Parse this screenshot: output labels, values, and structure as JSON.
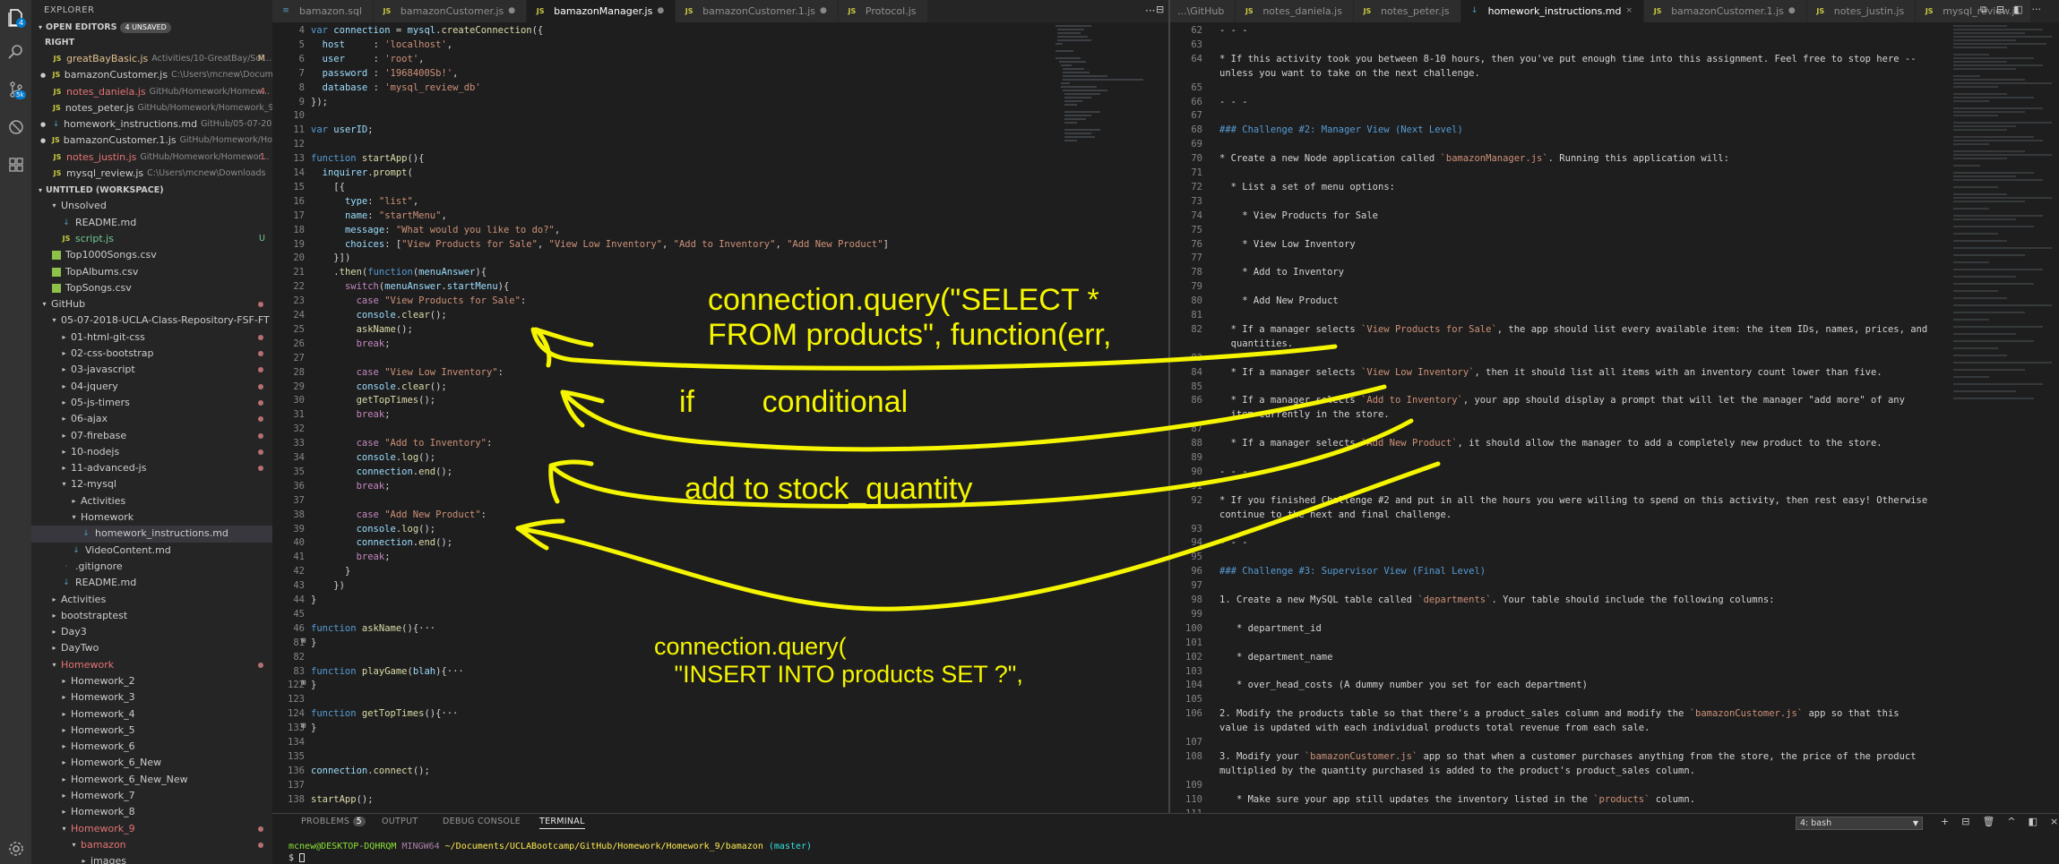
{
  "activity": {
    "badge_top": "4",
    "badge_scm": "5k"
  },
  "explorer": {
    "title": "EXPLORER",
    "open_editors_label": "OPEN EDITORS",
    "unsaved_badge": "4 UNSAVED",
    "group_right": "RIGHT",
    "open_files": [
      {
        "name": "greatBayBasic.js",
        "desc": "Activities/10-GreatBay/Sol...",
        "status": "M"
      },
      {
        "name": "bamazonCustomer.js",
        "desc": "C:\\Users\\mcnew\\Documen...",
        "status": ""
      },
      {
        "name": "notes_daniela.js",
        "desc": "GitHub/Homework/Homew...",
        "status": "4"
      },
      {
        "name": "notes_peter.js",
        "desc": "GitHub/Homework/Homework_9/...",
        "status": ""
      },
      {
        "name": "homework_instructions.md",
        "desc": "GitHub/05-07-2018...",
        "status": ""
      },
      {
        "name": "bamazonCustomer.1.js",
        "desc": "GitHub/Homework/Homew...",
        "status": ""
      },
      {
        "name": "notes_justin.js",
        "desc": "GitHub/Homework/Homewor...",
        "status": "1"
      },
      {
        "name": "mysql_review.js",
        "desc": "C:\\Users\\mcnew\\Downloads",
        "status": ""
      }
    ],
    "workspace_label": "UNTITLED (WORKSPACE)",
    "tree": [
      {
        "name": "Unsolved",
        "indent": 1,
        "type": "folder-open",
        "st": ""
      },
      {
        "name": "README.md",
        "indent": 2,
        "type": "md",
        "st": ""
      },
      {
        "name": "script.js",
        "indent": 2,
        "type": "js",
        "st": "U"
      },
      {
        "name": "Top1000Songs.csv",
        "indent": 1,
        "type": "csv",
        "st": ""
      },
      {
        "name": "TopAlbums.csv",
        "indent": 1,
        "type": "csv",
        "st": ""
      },
      {
        "name": "TopSongs.csv",
        "indent": 1,
        "type": "csv",
        "st": ""
      },
      {
        "name": "GitHub",
        "indent": 0,
        "type": "folder-open",
        "st": "dot"
      },
      {
        "name": "05-07-2018-UCLA-Class-Repository-FSF-FT",
        "indent": 1,
        "type": "folder-open",
        "st": ""
      },
      {
        "name": "01-html-git-css",
        "indent": 2,
        "type": "folder",
        "st": "dot"
      },
      {
        "name": "02-css-bootstrap",
        "indent": 2,
        "type": "folder",
        "st": "dot"
      },
      {
        "name": "03-javascript",
        "indent": 2,
        "type": "folder",
        "st": "dot"
      },
      {
        "name": "04-jquery",
        "indent": 2,
        "type": "folder",
        "st": "dot"
      },
      {
        "name": "05-js-timers",
        "indent": 2,
        "type": "folder",
        "st": "dot"
      },
      {
        "name": "06-ajax",
        "indent": 2,
        "type": "folder",
        "st": "dot"
      },
      {
        "name": "07-firebase",
        "indent": 2,
        "type": "folder",
        "st": "dot"
      },
      {
        "name": "10-nodejs",
        "indent": 2,
        "type": "folder",
        "st": "dot"
      },
      {
        "name": "11-advanced-js",
        "indent": 2,
        "type": "folder",
        "st": "dot"
      },
      {
        "name": "12-mysql",
        "indent": 2,
        "type": "folder-open",
        "st": ""
      },
      {
        "name": "Activities",
        "indent": 3,
        "type": "folder",
        "st": ""
      },
      {
        "name": "Homework",
        "indent": 3,
        "type": "folder-open",
        "st": ""
      },
      {
        "name": "homework_instructions.md",
        "indent": 4,
        "type": "md",
        "st": "",
        "sel": true
      },
      {
        "name": "VideoContent.md",
        "indent": 3,
        "type": "md",
        "st": ""
      },
      {
        "name": ".gitignore",
        "indent": 2,
        "type": "txt",
        "st": ""
      },
      {
        "name": "README.md",
        "indent": 2,
        "type": "md",
        "st": ""
      },
      {
        "name": "Activities",
        "indent": 1,
        "type": "folder",
        "st": ""
      },
      {
        "name": "bootstraptest",
        "indent": 1,
        "type": "folder",
        "st": ""
      },
      {
        "name": "Day3",
        "indent": 1,
        "type": "folder",
        "st": ""
      },
      {
        "name": "DayTwo",
        "indent": 1,
        "type": "folder",
        "st": ""
      },
      {
        "name": "Homework",
        "indent": 1,
        "type": "folder-open",
        "st": "dot",
        "red": true
      },
      {
        "name": "Homework_2",
        "indent": 2,
        "type": "folder",
        "st": ""
      },
      {
        "name": "Homework_3",
        "indent": 2,
        "type": "folder",
        "st": ""
      },
      {
        "name": "Homework_4",
        "indent": 2,
        "type": "folder",
        "st": ""
      },
      {
        "name": "Homework_5",
        "indent": 2,
        "type": "folder",
        "st": ""
      },
      {
        "name": "Homework_6",
        "indent": 2,
        "type": "folder",
        "st": ""
      },
      {
        "name": "Homework_6_New",
        "indent": 2,
        "type": "folder",
        "st": ""
      },
      {
        "name": "Homework_6_New_New",
        "indent": 2,
        "type": "folder",
        "st": ""
      },
      {
        "name": "Homework_7",
        "indent": 2,
        "type": "folder",
        "st": ""
      },
      {
        "name": "Homework_8",
        "indent": 2,
        "type": "folder",
        "st": ""
      },
      {
        "name": "Homework_9",
        "indent": 2,
        "type": "folder-open",
        "st": "dot",
        "red": true
      },
      {
        "name": "bamazon",
        "indent": 3,
        "type": "folder-open",
        "st": "dot",
        "red": true
      },
      {
        "name": "images",
        "indent": 4,
        "type": "folder",
        "st": ""
      }
    ]
  },
  "tabs_left": [
    {
      "name": "bamazon.sql",
      "active": false,
      "ic": "db"
    },
    {
      "name": "bamazonCustomer.js",
      "active": false,
      "ic": "js",
      "dot": true
    },
    {
      "name": "bamazonManager.js",
      "active": true,
      "ic": "js",
      "dot": true
    },
    {
      "name": "bamazonCustomer.1.js",
      "active": false,
      "ic": "js",
      "dot": true
    },
    {
      "name": "Protocol.js",
      "active": false,
      "ic": "js"
    }
  ],
  "tabs_right": [
    {
      "name": "...\\GitHub",
      "active": false,
      "ic": ""
    },
    {
      "name": "notes_daniela.js",
      "active": false,
      "ic": "js"
    },
    {
      "name": "notes_peter.js",
      "active": false,
      "ic": "js"
    },
    {
      "name": "homework_instructions.md",
      "active": true,
      "ic": "md",
      "close": true
    },
    {
      "name": "bamazonCustomer.1.js",
      "active": false,
      "ic": "js",
      "dot": true
    },
    {
      "name": "notes_justin.js",
      "active": false,
      "ic": "js"
    },
    {
      "name": "mysql_review.js",
      "active": false,
      "ic": "js"
    }
  ],
  "left_lines": [
    {
      "n": "4",
      "html": "<span class='kw'>var</span> <span class='vr'>connection</span> <span class='pl'>=</span> <span class='vr'>mysql</span><span class='pl'>.</span><span class='fn'>createConnection</span><span class='pl'>({</span>"
    },
    {
      "n": "5",
      "html": "  <span class='vr'>host</span>     <span class='pl'>:</span> <span class='st2'>'localhost'</span><span class='pl'>,</span>"
    },
    {
      "n": "6",
      "html": "  <span class='vr'>user</span>     <span class='pl'>:</span> <span class='st2'>'root'</span><span class='pl'>,</span>"
    },
    {
      "n": "7",
      "html": "  <span class='vr'>password</span> <span class='pl'>:</span> <span class='st2'>'1968400Sb!'</span><span class='pl'>,</span>"
    },
    {
      "n": "8",
      "html": "  <span class='vr'>database</span> <span class='pl'>:</span> <span class='st2'>'mysql_review_db'</span>"
    },
    {
      "n": "9",
      "html": "<span class='pl'>});</span>"
    },
    {
      "n": "10",
      "html": ""
    },
    {
      "n": "11",
      "html": "<span class='kw'>var</span> <span class='vr'>userID</span><span class='pl'>;</span>"
    },
    {
      "n": "12",
      "html": ""
    },
    {
      "n": "13",
      "html": "<span class='kw'>function</span> <span class='fn'>startApp</span><span class='pl'>(){</span>"
    },
    {
      "n": "14",
      "html": "  <span class='vr'>inquirer</span><span class='pl'>.</span><span class='fn'>prompt</span><span class='pl'>(</span>"
    },
    {
      "n": "15",
      "html": "    <span class='pl'>[{</span>"
    },
    {
      "n": "16",
      "html": "      <span class='vr'>type</span><span class='pl'>:</span> <span class='st2'>\"list\"</span><span class='pl'>,</span>"
    },
    {
      "n": "17",
      "html": "      <span class='vr'>name</span><span class='pl'>:</span> <span class='st2'>\"startMenu\"</span><span class='pl'>,</span>"
    },
    {
      "n": "18",
      "html": "      <span class='vr'>message</span><span class='pl'>:</span> <span class='st2'>\"What would you like to do?\"</span><span class='pl'>,</span>"
    },
    {
      "n": "19",
      "html": "      <span class='vr'>choices</span><span class='pl'>: [</span><span class='st2'>\"View Products for Sale\"</span><span class='pl'>, </span><span class='st2'>\"View Low Inventory\"</span><span class='pl'>, </span><span class='st2'>\"Add to Inventory\"</span><span class='pl'>, </span><span class='st2'>\"Add New Product\"</span><span class='pl'>]</span>"
    },
    {
      "n": "20",
      "html": "    <span class='pl'>}])</span>"
    },
    {
      "n": "21",
      "html": "    <span class='pl'>.</span><span class='fn'>then</span><span class='pl'>(</span><span class='kw'>function</span><span class='pl'>(</span><span class='vr'>menuAnswer</span><span class='pl'>){</span>"
    },
    {
      "n": "22",
      "html": "      <span class='kc'>switch</span><span class='pl'>(</span><span class='vr'>menuAnswer</span><span class='pl'>.</span><span class='vr'>startMenu</span><span class='pl'>){</span>"
    },
    {
      "n": "23",
      "html": "        <span class='kc'>case</span> <span class='st2'>\"View Products for Sale\"</span><span class='pl'>:</span>"
    },
    {
      "n": "24",
      "html": "        <span class='vr'>console</span><span class='pl'>.</span><span class='fn'>clear</span><span class='pl'>();</span>"
    },
    {
      "n": "25",
      "html": "        <span class='fn'>askName</span><span class='pl'>();</span>"
    },
    {
      "n": "26",
      "html": "        <span class='kc'>break</span><span class='pl'>;</span>"
    },
    {
      "n": "27",
      "html": ""
    },
    {
      "n": "28",
      "html": "        <span class='kc'>case</span> <span class='st2'>\"View Low Inventory\"</span><span class='pl'>:</span>"
    },
    {
      "n": "29",
      "html": "        <span class='vr'>console</span><span class='pl'>.</span><span class='fn'>clear</span><span class='pl'>();</span>"
    },
    {
      "n": "30",
      "html": "        <span class='fn'>getTopTimes</span><span class='pl'>();</span>"
    },
    {
      "n": "31",
      "html": "        <span class='kc'>break</span><span class='pl'>;</span>"
    },
    {
      "n": "32",
      "html": ""
    },
    {
      "n": "33",
      "html": "        <span class='kc'>case</span> <span class='st2'>\"Add to Inventory\"</span><span class='pl'>:</span>"
    },
    {
      "n": "34",
      "html": "        <span class='vr'>console</span><span class='pl'>.</span><span class='fn'>log</span><span class='pl'>();</span>"
    },
    {
      "n": "35",
      "html": "        <span class='vr'>connection</span><span class='pl'>.</span><span class='fn'>end</span><span class='pl'>();</span>"
    },
    {
      "n": "36",
      "html": "        <span class='kc'>break</span><span class='pl'>;</span>"
    },
    {
      "n": "37",
      "html": ""
    },
    {
      "n": "38",
      "html": "        <span class='kc'>case</span> <span class='st2'>\"Add New Product\"</span><span class='pl'>:</span>"
    },
    {
      "n": "39",
      "html": "        <span class='vr'>console</span><span class='pl'>.</span><span class='fn'>log</span><span class='pl'>();</span>"
    },
    {
      "n": "40",
      "html": "        <span class='vr'>connection</span><span class='pl'>.</span><span class='fn'>end</span><span class='pl'>();</span>"
    },
    {
      "n": "41",
      "html": "        <span class='kc'>break</span><span class='pl'>;</span>"
    },
    {
      "n": "42",
      "html": "      <span class='pl'>}</span>"
    },
    {
      "n": "43",
      "html": "    <span class='pl'>})</span>"
    },
    {
      "n": "44",
      "html": "<span class='pl'>}</span>"
    },
    {
      "n": "45",
      "html": ""
    },
    {
      "n": "46",
      "html": "<span class='kw'>function</span> <span class='fn'>askName</span><span class='pl'>(){···</span>"
    },
    {
      "n": "81",
      "html": "<span class='pl'>}</span>"
    },
    {
      "n": "82",
      "html": ""
    },
    {
      "n": "83",
      "html": "<span class='kw'>function</span> <span class='fn'>playGame</span><span class='pl'>(</span><span class='vr'>blah</span><span class='pl'>){···</span>"
    },
    {
      "n": "122",
      "html": "<span class='pl'>}</span>"
    },
    {
      "n": "123",
      "html": ""
    },
    {
      "n": "124",
      "html": "<span class='kw'>function</span> <span class='fn'>getTopTimes</span><span class='pl'>(){···</span>"
    },
    {
      "n": "133",
      "html": "<span class='pl'>}</span>"
    },
    {
      "n": "134",
      "html": ""
    },
    {
      "n": "135",
      "html": ""
    },
    {
      "n": "136",
      "html": "<span class='vr'>connection</span><span class='pl'>.</span><span class='fn'>connect</span><span class='pl'>();</span>"
    },
    {
      "n": "137",
      "html": ""
    },
    {
      "n": "138",
      "html": "<span class='fn'>startApp</span><span class='pl'>();</span>"
    }
  ],
  "right_lines": [
    {
      "n": "62",
      "t": "- - -"
    },
    {
      "n": "63",
      "t": ""
    },
    {
      "n": "64",
      "t": "* If this activity took you between 8-10 hours, then you've put enough time into this assignment. Feel free to stop here --"
    },
    {
      "n": "",
      "t": "unless you want to take on the next challenge."
    },
    {
      "n": "65",
      "t": ""
    },
    {
      "n": "66",
      "t": "- - -"
    },
    {
      "n": "67",
      "t": ""
    },
    {
      "n": "68",
      "t": "### Challenge #2: Manager View (Next Level)",
      "h": true
    },
    {
      "n": "69",
      "t": ""
    },
    {
      "n": "70",
      "t": "* Create a new Node application called `bamazonManager.js`. Running this application will:"
    },
    {
      "n": "71",
      "t": ""
    },
    {
      "n": "72",
      "t": "  * List a set of menu options:"
    },
    {
      "n": "73",
      "t": ""
    },
    {
      "n": "74",
      "t": "    * View Products for Sale"
    },
    {
      "n": "75",
      "t": ""
    },
    {
      "n": "76",
      "t": "    * View Low Inventory"
    },
    {
      "n": "77",
      "t": ""
    },
    {
      "n": "78",
      "t": "    * Add to Inventory"
    },
    {
      "n": "79",
      "t": ""
    },
    {
      "n": "80",
      "t": "    * Add New Product"
    },
    {
      "n": "81",
      "t": ""
    },
    {
      "n": "82",
      "t": "  * If a manager selects `View Products for Sale`, the app should list every available item: the item IDs, names, prices, and"
    },
    {
      "n": "",
      "t": "  quantities."
    },
    {
      "n": "83",
      "t": ""
    },
    {
      "n": "84",
      "t": "  * If a manager selects `View Low Inventory`, then it should list all items with an inventory count lower than five."
    },
    {
      "n": "85",
      "t": ""
    },
    {
      "n": "86",
      "t": "  * If a manager selects `Add to Inventory`, your app should display a prompt that will let the manager \"add more\" of any"
    },
    {
      "n": "",
      "t": "  item currently in the store."
    },
    {
      "n": "87",
      "t": ""
    },
    {
      "n": "88",
      "t": "  * If a manager selects `Add New Product`, it should allow the manager to add a completely new product to the store."
    },
    {
      "n": "89",
      "t": ""
    },
    {
      "n": "90",
      "t": "- - -"
    },
    {
      "n": "91",
      "t": ""
    },
    {
      "n": "92",
      "t": "* If you finished Challenge #2 and put in all the hours you were willing to spend on this activity, then rest easy! Otherwise"
    },
    {
      "n": "",
      "t": "continue to the next and final challenge."
    },
    {
      "n": "93",
      "t": ""
    },
    {
      "n": "94",
      "t": "- - -"
    },
    {
      "n": "95",
      "t": ""
    },
    {
      "n": "96",
      "t": "### Challenge #3: Supervisor View (Final Level)",
      "h": true
    },
    {
      "n": "97",
      "t": ""
    },
    {
      "n": "98",
      "t": "1. Create a new MySQL table called `departments`. Your table should include the following columns:"
    },
    {
      "n": "99",
      "t": ""
    },
    {
      "n": "100",
      "t": "   * department_id"
    },
    {
      "n": "101",
      "t": ""
    },
    {
      "n": "102",
      "t": "   * department_name"
    },
    {
      "n": "103",
      "t": ""
    },
    {
      "n": "104",
      "t": "   * over_head_costs (A dummy number you set for each department)"
    },
    {
      "n": "105",
      "t": ""
    },
    {
      "n": "106",
      "t": "2. Modify the products table so that there's a product_sales column and modify the `bamazonCustomer.js` app so that this"
    },
    {
      "n": "",
      "t": "value is updated with each individual products total revenue from each sale."
    },
    {
      "n": "107",
      "t": ""
    },
    {
      "n": "108",
      "t": "3. Modify your `bamazonCustomer.js` app so that when a customer purchases anything from the store, the price of the product"
    },
    {
      "n": "",
      "t": "multiplied by the quantity purchased is added to the product's product_sales column."
    },
    {
      "n": "109",
      "t": ""
    },
    {
      "n": "110",
      "t": "   * Make sure your app still updates the inventory listed in the `products` column."
    },
    {
      "n": "111",
      "t": ""
    }
  ],
  "panel": {
    "problems": "PROBLEMS",
    "problems_count": "5",
    "output": "OUTPUT",
    "debug": "DEBUG CONSOLE",
    "terminal": "TERMINAL",
    "shell": "4: bash",
    "prompt_user": "mcnew@DESKTOP-DQHRQM",
    "prompt_host": "MINGW64",
    "prompt_path": "~/Documents/UCLABootcamp/GitHub/Homework/Homework_9/bamazon",
    "prompt_branch": "(master)",
    "prompt_symbol": "$"
  },
  "annotations": {
    "note1": "connection.query(\"SELECT *\nFROM products\", function(err,",
    "note2": "if        conditional",
    "note3": "add to stock_quantity",
    "note4": "connection.query(\n   \"INSERT INTO products SET ?\","
  }
}
